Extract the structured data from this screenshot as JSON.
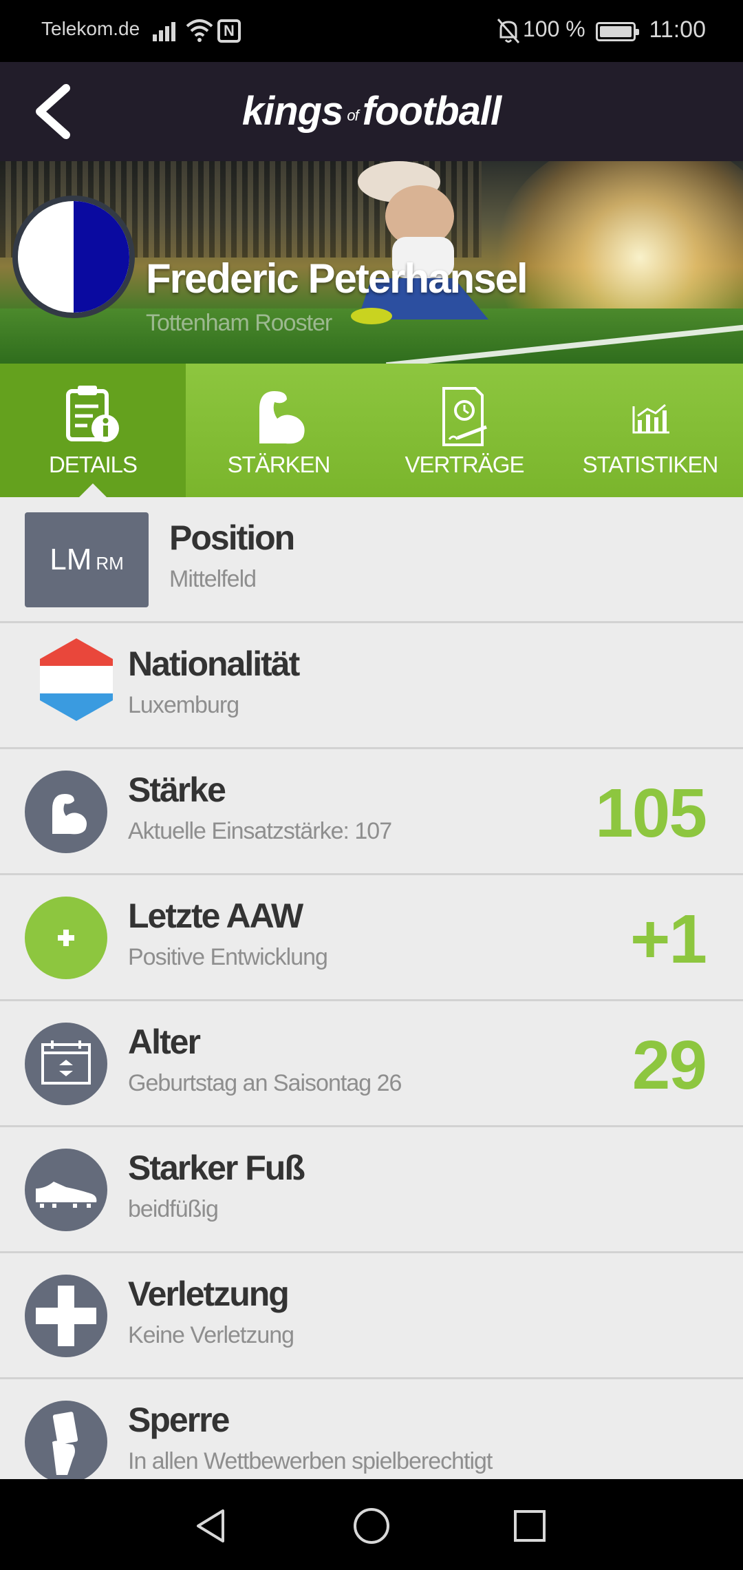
{
  "status_bar": {
    "carrier": "Telekom.de",
    "battery": "100 %",
    "time": "11:00",
    "icons": [
      "signal-icon",
      "wifi-icon",
      "nfc-icon",
      "bell-off-icon",
      "battery-icon"
    ]
  },
  "app": {
    "logo_part1": "kings",
    "logo_part2": "of",
    "logo_part3": "football",
    "back_icon": "back-arrow-icon"
  },
  "player": {
    "name": "Frederic Peterhansel",
    "club": "Tottenham Rooster",
    "crest_colors": [
      "#ffffff",
      "#0a0aa0"
    ]
  },
  "tabs": [
    {
      "label": "DETAILS",
      "icon": "clipboard-info-icon",
      "active": true
    },
    {
      "label": "STÄRKEN",
      "icon": "muscle-icon",
      "active": false
    },
    {
      "label": "VERTRÄGE",
      "icon": "contract-icon",
      "active": false
    },
    {
      "label": "STATISTIKEN",
      "icon": "bar-chart-icon",
      "active": false
    }
  ],
  "details": {
    "position": {
      "main": "LM",
      "alt": "RM",
      "title": "Position",
      "subtitle": "Mittelfeld"
    },
    "nationality": {
      "title": "Nationalität",
      "subtitle": "Luxemburg",
      "icon": "flag-luxembourg-icon"
    },
    "strength": {
      "title": "Stärke",
      "subtitle": "Aktuelle Einsatzstärke: 107",
      "value": "105",
      "icon": "muscle-icon"
    },
    "last_aaw": {
      "title": "Letzte AAW",
      "subtitle": "Positive Entwicklung",
      "value": "+1",
      "icon": "plus-icon"
    },
    "age": {
      "title": "Alter",
      "subtitle": "Geburtstag an Saisontag 26",
      "value": "29",
      "icon": "calendar-icon"
    },
    "strong_foot": {
      "title": "Starker Fuß",
      "subtitle": "beidfüßig",
      "icon": "boot-icon"
    },
    "injury": {
      "title": "Verletzung",
      "subtitle": "Keine Verletzung",
      "icon": "medical-cross-icon"
    },
    "suspension": {
      "title": "Sperre",
      "subtitle": "In allen Wettbewerben spielberechtigt",
      "icon": "card-hand-icon"
    }
  },
  "colors": {
    "accent_green": "#8dc63f",
    "active_tab": "#64a11e",
    "icon_circle": "#646b7b",
    "header_bg": "#221d2a"
  },
  "nav": [
    "back-triangle-icon",
    "home-circle-icon",
    "recents-square-icon"
  ]
}
